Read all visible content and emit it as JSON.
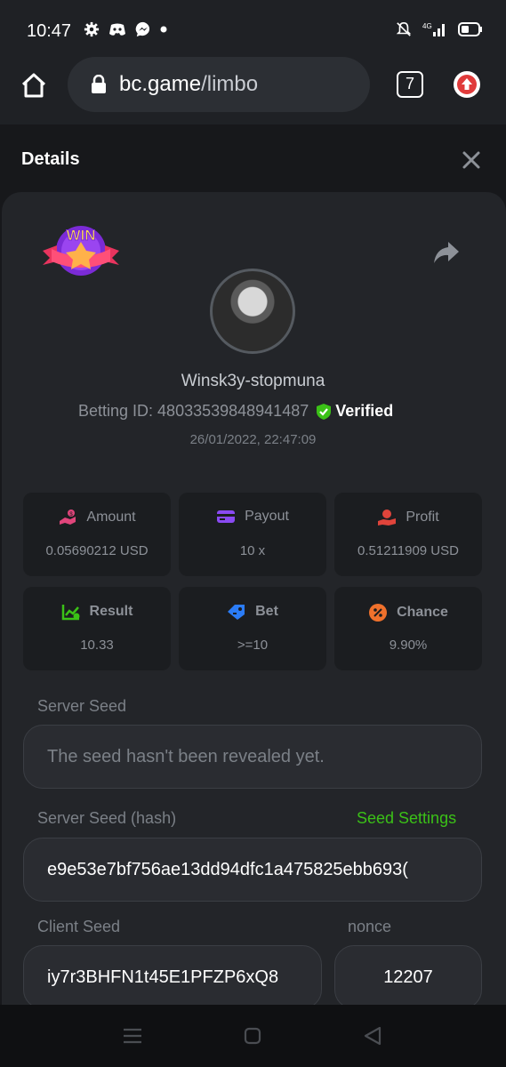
{
  "statusbar": {
    "time": "10:47",
    "icons": [
      "gear-icon",
      "discord-icon",
      "messenger-icon",
      "dot-icon"
    ],
    "right_icons": [
      "mute-bell-icon",
      "signal-4g-icon",
      "battery-icon"
    ]
  },
  "browser": {
    "url_host": "bc.game",
    "url_path": "/limbo",
    "tab_count": "7"
  },
  "header": {
    "title": "Details"
  },
  "bet": {
    "username": "Winsk3y-stopmuna",
    "betting_id_label": "Betting ID: 4803353984894​1487",
    "verified": "Verified",
    "date": "26/01/2022, 22:47:09"
  },
  "stats": [
    {
      "label": "Amount",
      "value": "0.05690212 USD",
      "color": "#e0457b"
    },
    {
      "label": "Payout",
      "value": "10 x",
      "color": "#8a4af3"
    },
    {
      "label": "Profit",
      "value": "0.51211909 USD",
      "color": "#e0443b"
    },
    {
      "label": "Result",
      "value": "10.33",
      "color": "#3bc117"
    },
    {
      "label": "Bet",
      "value": ">=10",
      "color": "#2b7cf6"
    },
    {
      "label": "Chance",
      "value": "9.90%",
      "color": "#f0712c"
    }
  ],
  "seeds": {
    "server_seed_label": "Server Seed",
    "server_seed_value": "The seed hasn't been revealed yet.",
    "server_hash_label": "Server Seed (hash)",
    "seed_settings": "Seed Settings",
    "server_hash_value": "e9e53e7bf756ae13dd94dfc1a475825ebb693(",
    "client_seed_label": "Client Seed",
    "client_seed_value": "iy7r3BHFN1t45E1PFZP6xQ8",
    "nonce_label": "nonce",
    "nonce_value": "12207"
  }
}
